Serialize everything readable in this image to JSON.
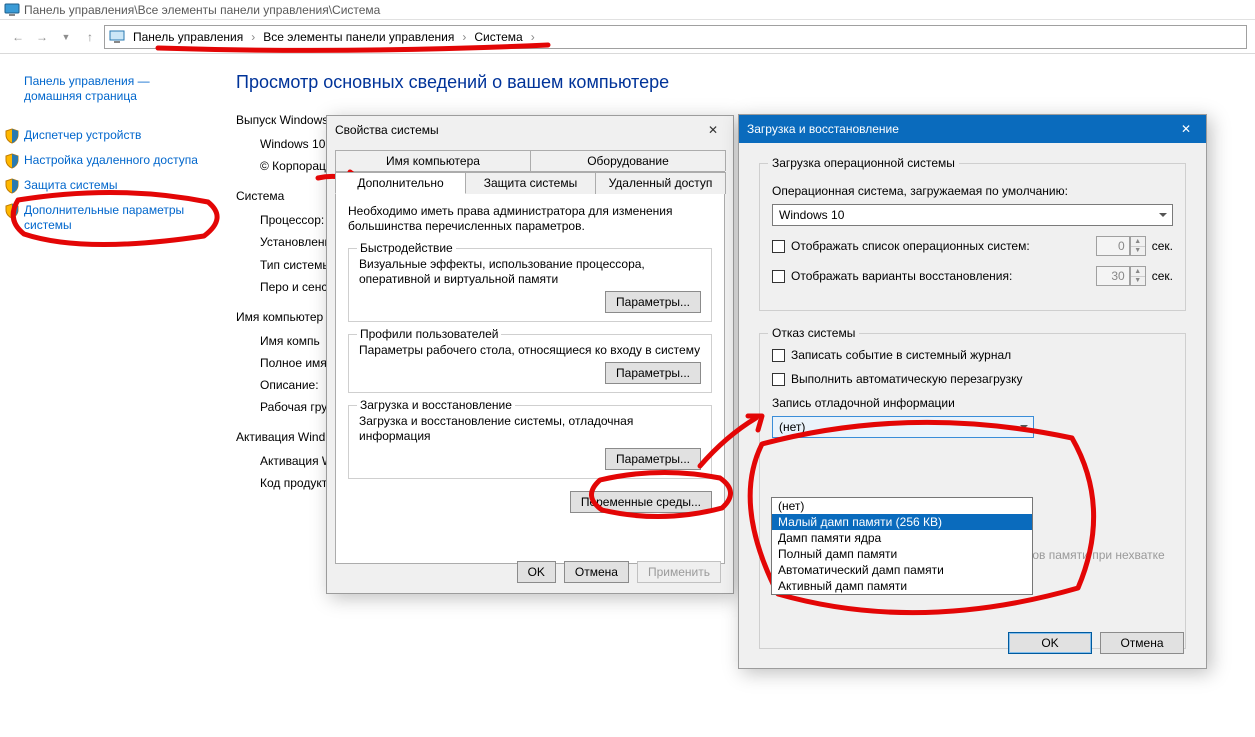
{
  "window": {
    "title_path": "Панель управления\\Все элементы панели управления\\Система",
    "breadcrumb": [
      "Панель управления",
      "Все элементы панели управления",
      "Система"
    ]
  },
  "sidebar": {
    "home": "Панель управления — домашняя страница",
    "links": [
      "Диспетчер устройств",
      "Настройка удаленного доступа",
      "Защита системы",
      "Дополнительные параметры системы"
    ]
  },
  "main": {
    "heading": "Просмотр основных сведений о вашем компьютере",
    "edition_label": "Выпуск Windows",
    "edition_rows": [
      "Windows 10",
      "© Корпорац"
    ],
    "system_label": "Система",
    "system_rows": [
      "Процессор:",
      "Установленн (ОЗУ):",
      "Тип системы",
      "Перо и сенс"
    ],
    "name_label": "Имя компьютер",
    "name_rows": [
      "Имя компь",
      "Полное имя",
      "Описание:",
      "Рабочая гру"
    ],
    "activation_label": "Активация Wind",
    "activation_rows": [
      "Активация W",
      "Код продукт"
    ]
  },
  "sysprops": {
    "title": "Свойства системы",
    "tabs_row1": [
      "Имя компьютера",
      "Оборудование"
    ],
    "tabs_row2": [
      "Дополнительно",
      "Защита системы",
      "Удаленный доступ"
    ],
    "active_tab": "Дополнительно",
    "note": "Необходимо иметь права администратора для изменения большинства перечисленных параметров.",
    "groups": [
      {
        "title": "Быстродействие",
        "desc": "Визуальные эффекты, использование процессора, оперативной и виртуальной памяти",
        "button": "Параметры..."
      },
      {
        "title": "Профили пользователей",
        "desc": "Параметры рабочего стола, относящиеся ко входу в систему",
        "button": "Параметры..."
      },
      {
        "title": "Загрузка и восстановление",
        "desc": "Загрузка и восстановление системы, отладочная информация",
        "button": "Параметры..."
      }
    ],
    "env_button": "Переменные среды...",
    "ok": "OK",
    "cancel": "Отмена",
    "apply": "Применить"
  },
  "startup": {
    "title": "Загрузка и восстановление",
    "boot_group": "Загрузка операционной системы",
    "default_os_label": "Операционная система, загружаемая по умолчанию:",
    "default_os_value": "Windows 10",
    "show_os_list": "Отображать список операционных систем:",
    "show_os_list_sec": "0",
    "show_recovery": "Отображать варианты восстановления:",
    "show_recovery_sec": "30",
    "sec_suffix": "сек.",
    "fail_group": "Отказ системы",
    "log_event": "Записать событие в системный журнал",
    "auto_restart": "Выполнить автоматическую перезагрузку",
    "debug_label": "Запись отладочной информации",
    "debug_selected": "(нет)",
    "debug_options": [
      "(нет)",
      "Малый дамп памяти (256 КВ)",
      "Дамп памяти ядра",
      "Полный дамп памяти",
      "Автоматический дамп памяти",
      "Активный дамп памяти"
    ],
    "debug_highlight_index": 1,
    "disable_auto_delete": "Отключить автоматическое удаление дампов памяти при нехватке места на диске",
    "ok": "OK",
    "cancel": "Отмена"
  }
}
